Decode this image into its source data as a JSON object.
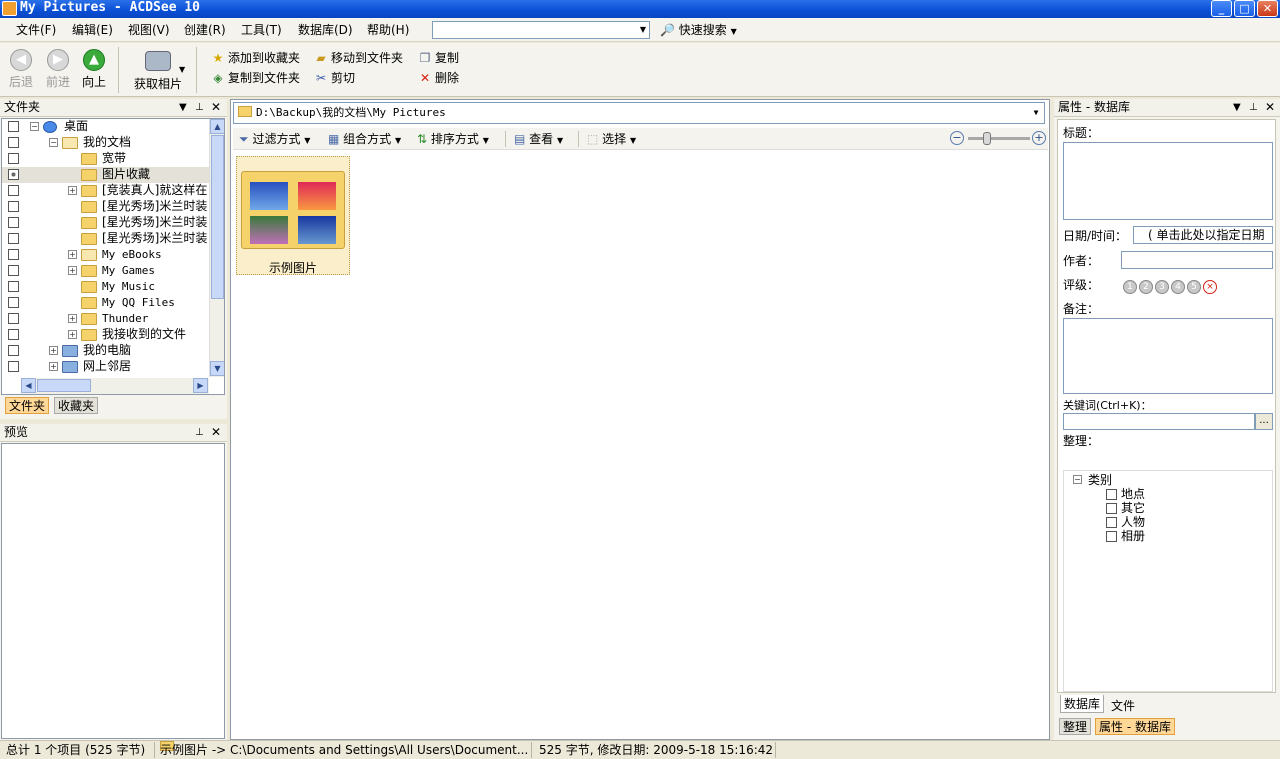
{
  "window": {
    "title": "My Pictures - ACDSee 10",
    "minimize": "_",
    "maximize": "□",
    "close": "✕"
  },
  "menu": {
    "items": [
      "文件(F)",
      "编辑(E)",
      "视图(V)",
      "创建(R)",
      "工具(T)",
      "数据库(D)",
      "帮助(H)"
    ],
    "search_value": "",
    "quick_search": "快速搜索"
  },
  "toolbar": {
    "back": "后退",
    "forward": "前进",
    "up": "向上",
    "acquire": "获取相片",
    "add_to_favorites": "添加到收藏夹",
    "move_to_folder": "移动到文件夹",
    "copy": "复制",
    "copy_to_folder": "复制到文件夹",
    "cut": "剪切",
    "delete": "删除"
  },
  "folders_pane": {
    "title": "文件夹",
    "tree": [
      {
        "label": "桌面",
        "level": 0,
        "expander": "-",
        "icon": "desktop-icon",
        "mono": false
      },
      {
        "label": "我的文档",
        "level": 1,
        "expander": "-",
        "icon": "documents-icon",
        "mono": false
      },
      {
        "label": "宽带",
        "level": 2,
        "expander": "",
        "icon": "folder-icon",
        "mono": false
      },
      {
        "label": "图片收藏",
        "level": 2,
        "expander": "",
        "icon": "pictures-folder-icon",
        "mono": false,
        "selected": true,
        "checked": "partial"
      },
      {
        "label": "[竞装真人]就这样在",
        "level": 2,
        "expander": "+",
        "icon": "folder-icon",
        "mono": false
      },
      {
        "label": "[星光秀场]米兰时装",
        "level": 2,
        "expander": "",
        "icon": "folder-icon",
        "mono": false
      },
      {
        "label": "[星光秀场]米兰时装",
        "level": 2,
        "expander": "",
        "icon": "folder-icon",
        "mono": false
      },
      {
        "label": "[星光秀场]米兰时装",
        "level": 2,
        "expander": "",
        "icon": "folder-icon",
        "mono": false
      },
      {
        "label": "My eBooks",
        "level": 2,
        "expander": "+",
        "icon": "ebooks-folder-icon",
        "mono": true
      },
      {
        "label": "My Games",
        "level": 2,
        "expander": "+",
        "icon": "folder-icon",
        "mono": true
      },
      {
        "label": "My Music",
        "level": 2,
        "expander": "",
        "icon": "folder-icon",
        "mono": true
      },
      {
        "label": "My QQ Files",
        "level": 2,
        "expander": "",
        "icon": "folder-icon",
        "mono": true
      },
      {
        "label": "Thunder",
        "level": 2,
        "expander": "+",
        "icon": "folder-icon",
        "mono": true
      },
      {
        "label": "我接收到的文件",
        "level": 2,
        "expander": "+",
        "icon": "folder-icon",
        "mono": false
      },
      {
        "label": "我的电脑",
        "level": 1,
        "expander": "+",
        "icon": "computer-icon",
        "mono": false
      },
      {
        "label": "网上邻居",
        "level": 1,
        "expander": "+",
        "icon": "network-icon",
        "mono": false
      }
    ],
    "tab_folders": "文件夹",
    "tab_favorites": "收藏夹"
  },
  "preview_pane": {
    "title": "预览"
  },
  "browser": {
    "path": "D:\\Backup\\我的文档\\My Pictures",
    "filter": "过滤方式",
    "group": "组合方式",
    "sort": "排序方式",
    "view": "查看",
    "select": "选择",
    "zoom_level": 0.3,
    "items": [
      {
        "name": "示例图片"
      }
    ]
  },
  "properties_pane": {
    "title": "属性 - 数据库",
    "caption_label": "标题：",
    "date_label": "日期/时间：",
    "date_placeholder": "( 单击此处以指定日期",
    "author_label": "作者：",
    "rating_label": "评级：",
    "ratings": [
      "1",
      "2",
      "3",
      "4",
      "5",
      "×"
    ],
    "notes_label": "备注：",
    "keywords_label": "关键词(Ctrl+K)：",
    "keywords_button": "...",
    "organize_label": "整理：",
    "categories_root": "类别",
    "categories": [
      "地点",
      "其它",
      "人物",
      "相册"
    ],
    "tab_database": "数据库",
    "tab_file": "文件",
    "bottom_tab_organize": "整理",
    "bottom_tab_properties": "属性 - 数据库"
  },
  "status": {
    "total": "总计 1 个项目 (525 字节)",
    "item": "示例图片 -> C:\\Documents and Settings\\All Users\\Document...",
    "info": "525 字节, 修改日期: 2009-5-18 15:16:42"
  }
}
